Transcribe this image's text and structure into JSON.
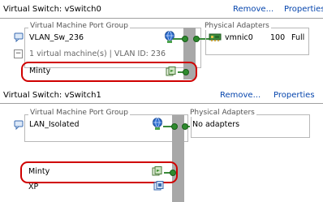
{
  "switch0": {
    "title": "Virtual Switch: vSwitch0",
    "remove_label": "Remove...",
    "properties_label": "Properties",
    "vm_port_group_legend": "Virtual Machine Port Group",
    "port_group_name": "VLAN_Sw_236",
    "summary": "1 virtual machine(s) | VLAN ID: 236",
    "expand_toggle": "−",
    "vms": [
      {
        "name": "Minty"
      }
    ],
    "physical_adapters_legend": "Physical Adapters",
    "adapter": {
      "name": "vmnic0",
      "speed": "100",
      "duplex": "Full"
    }
  },
  "switch1": {
    "title": "Virtual Switch: vSwitch1",
    "remove_label": "Remove...",
    "properties_label": "Properties",
    "vm_port_group_legend": "Virtual Machine Port Group",
    "port_group_name": "LAN_Isolated",
    "physical_adapters_legend": "Physical Adapters",
    "no_adapters": "No adapters",
    "vms": [
      {
        "name": "Minty"
      },
      {
        "name": "XP"
      }
    ]
  }
}
